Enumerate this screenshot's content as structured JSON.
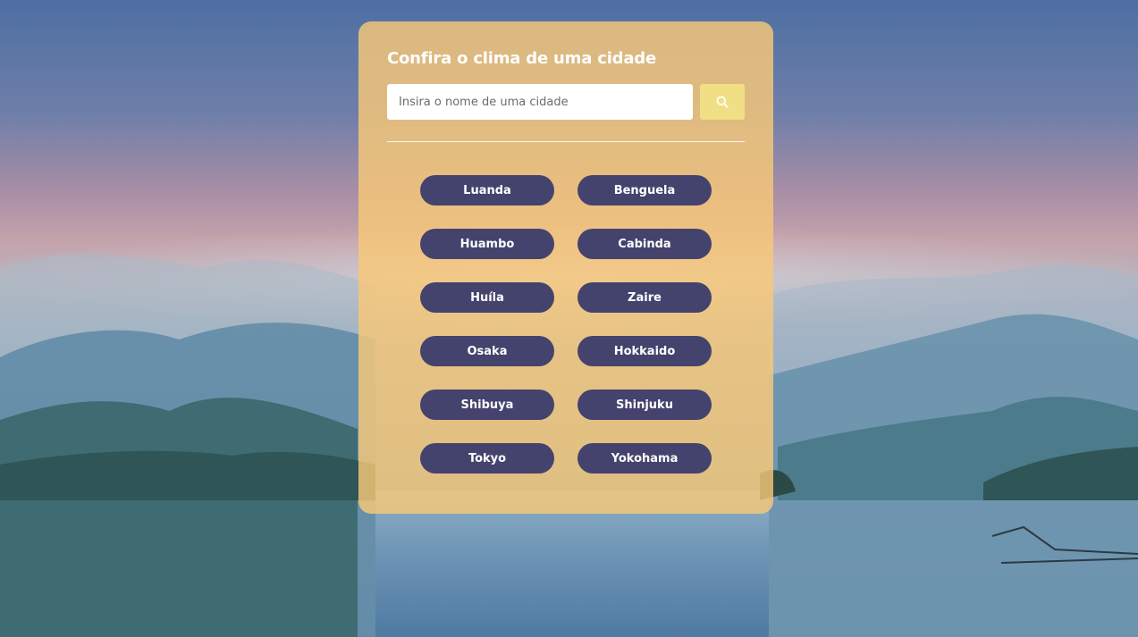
{
  "page": {
    "title": "Confira o clima de uma cidade"
  },
  "search": {
    "placeholder": "Insira o nome de uma cidade",
    "value": "",
    "button_icon": "search-icon"
  },
  "cities": [
    "Luanda",
    "Benguela",
    "Huambo",
    "Cabinda",
    "Huíla",
    "Zaire",
    "Osaka",
    "Hokkaido",
    "Shibuya",
    "Shinjuku",
    "Tokyo",
    "Yokohama"
  ],
  "colors": {
    "card_background": "#f8c878",
    "city_button": "#44436e",
    "search_button": "#f0df85",
    "text_light": "#ffffff"
  }
}
